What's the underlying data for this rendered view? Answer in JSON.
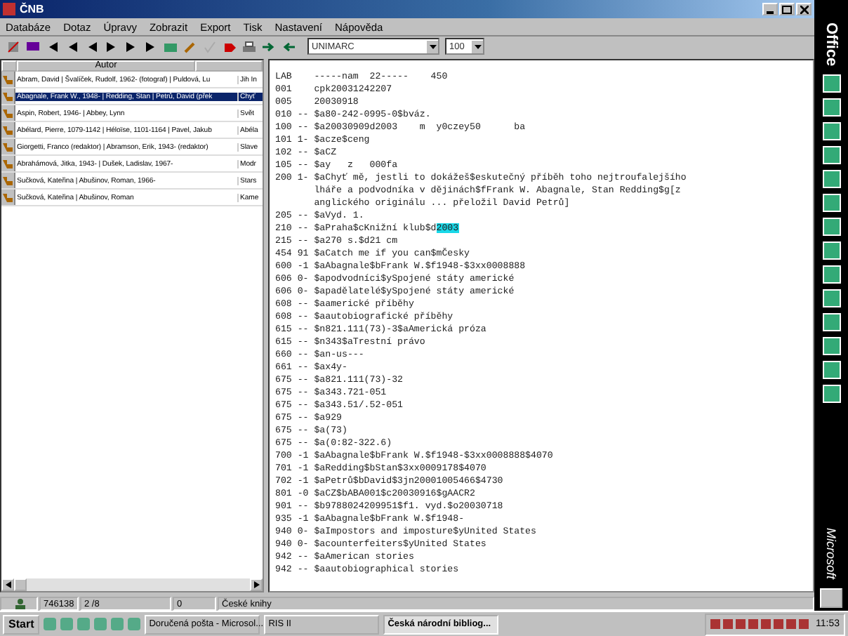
{
  "window": {
    "title": "ČNB"
  },
  "menu": [
    "Databáze",
    "Dotaz",
    "Úpravy",
    "Zobrazit",
    "Export",
    "Tisk",
    "Nastavení",
    "Nápověda"
  ],
  "toolbar": {
    "format": "UNIMARC",
    "count": "100"
  },
  "list": {
    "columns": [
      "Autor"
    ],
    "rows": [
      {
        "author": "Abram, David | Švalíček, Rudolf, 1962- (fotograf) | Puldová, Lu",
        "column_3": "Jih In",
        "selected": false
      },
      {
        "author": "Abagnale, Frank W., 1948- | Redding, Stan | Petrů, David (přek",
        "column_3": "Chyť",
        "selected": true
      },
      {
        "author": "Aspin, Robert, 1946- | Abbey, Lynn",
        "column_3": "Svět",
        "selected": false
      },
      {
        "author": "Abélard, Pierre, 1079-1142 | Héloïse, 1101-1164 | Pavel, Jakub",
        "column_3": "Abéla",
        "selected": false
      },
      {
        "author": "Giorgetti, Franco (redaktor) | Abramson, Erik, 1943- (redaktor)",
        "column_3": "Slave",
        "selected": false
      },
      {
        "author": "Abrahámová, Jitka, 1943- | Dušek, Ladislav, 1967-",
        "column_3": "Modr",
        "selected": false
      },
      {
        "author": "Sučková, Kateřina | Abušinov, Roman, 1966-",
        "column_3": "Stars",
        "selected": false
      },
      {
        "author": "Sučková, Kateřina | Abušinov, Roman",
        "column_3": "Kame",
        "selected": false
      }
    ]
  },
  "record": [
    {
      "text": "LAB    -----nam  22-----    450"
    },
    {
      "text": "001    cpk20031242207"
    },
    {
      "text": "005    20030918"
    },
    {
      "text": "010 -- $a80-242-0995-0$bváz."
    },
    {
      "text": "100 -- $a20030909d2003    m  y0czey50      ba"
    },
    {
      "text": "101 1- $acze$ceng"
    },
    {
      "text": "102 -- $aCZ"
    },
    {
      "text": "105 -- $ay   z   000fa"
    },
    {
      "text": "200 1- $aChyť mě, jestli to dokážeš$eskutečný příběh toho nejtroufalejšího"
    },
    {
      "text": "       lháře a podvodníka v dějinách$fFrank W. Abagnale, Stan Redding$g[z"
    },
    {
      "text": "       anglického originálu ... přeložil David Petrů]"
    },
    {
      "text": "205 -- $aVyd. 1."
    },
    {
      "text": "210 -- $aPraha$cKnižní klub$d",
      "highlight": "2003"
    },
    {
      "text": "215 -- $a270 s.$d21 cm"
    },
    {
      "text": "454 91 $aCatch me if you can$mČesky"
    },
    {
      "text": "600 -1 $aAbagnale$bFrank W.$f1948-$3xx0008888"
    },
    {
      "text": "606 0- $apodvodníci$ySpojené státy americké"
    },
    {
      "text": "606 0- $apadělatelé$ySpojené státy americké"
    },
    {
      "text": "608 -- $aamerické příběhy"
    },
    {
      "text": "608 -- $aautobiografické příběhy"
    },
    {
      "text": "615 -- $n821.111(73)-3$aAmerická próza"
    },
    {
      "text": "615 -- $n343$aTrestní právo"
    },
    {
      "text": "660 -- $an-us---"
    },
    {
      "text": "661 -- $ax4y-"
    },
    {
      "text": "675 -- $a821.111(73)-32"
    },
    {
      "text": "675 -- $a343.721-051"
    },
    {
      "text": "675 -- $a343.51/.52-051"
    },
    {
      "text": "675 -- $a929"
    },
    {
      "text": "675 -- $a(73)"
    },
    {
      "text": "675 -- $a(0:82-322.6)"
    },
    {
      "text": "700 -1 $aAbagnale$bFrank W.$f1948-$3xx0008888$4070"
    },
    {
      "text": "701 -1 $aRedding$bStan$3xx0009178$4070"
    },
    {
      "text": "702 -1 $aPetrů$bDavid$3jn20001005466$4730"
    },
    {
      "text": "801 -0 $aCZ$bABA001$c20030916$gAACR2"
    },
    {
      "text": "901 -- $b9788024209951$f1. vyd.$o20030718"
    },
    {
      "text": "935 -1 $aAbagnale$bFrank W.$f1948-"
    },
    {
      "text": "940 0- $aImpostors and imposture$yUnited States"
    },
    {
      "text": "940 0- $acounterfeiters$yUnited States"
    },
    {
      "text": "942 -- $aAmerican stories"
    },
    {
      "text": "942 -- $aautobiographical stories"
    }
  ],
  "status_bar": [
    "746138",
    "2 /8",
    "0",
    "České knihy"
  ],
  "office_bar": {
    "title": "Office",
    "brand": "Microsoft"
  },
  "taskbar": {
    "start": "Start",
    "tasks": [
      {
        "label": "Doručená pošta - Microsol...",
        "selected": false
      },
      {
        "label": "RIS II",
        "selected": false
      },
      {
        "label": "Česká národní bibliog...",
        "selected": true
      }
    ],
    "clock": "11:53"
  }
}
